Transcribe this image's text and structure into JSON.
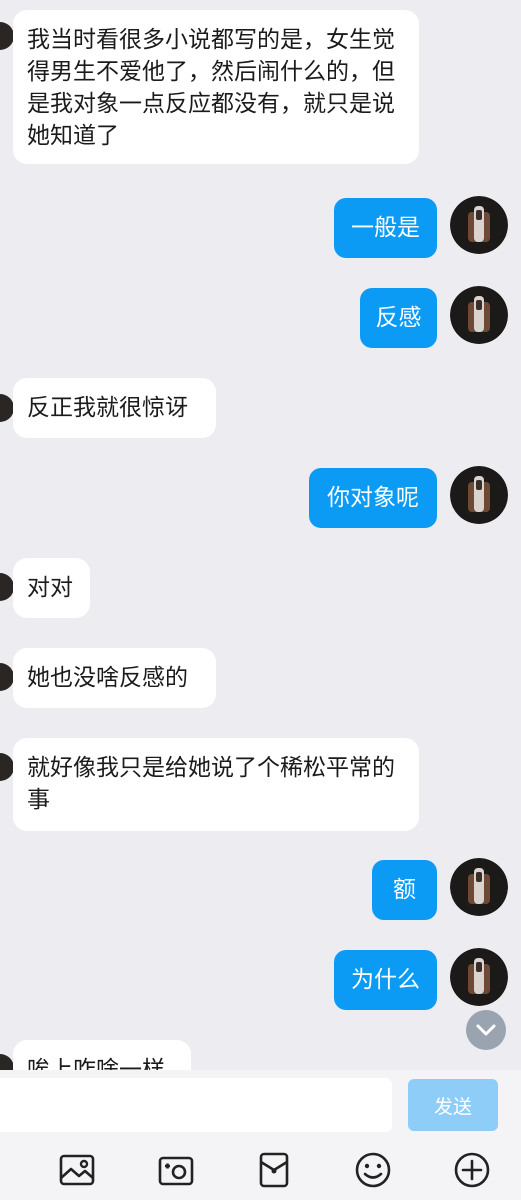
{
  "messages": [
    {
      "side": "in",
      "text": "我当时看很多小说都写的是，女生觉得男生不爱他了，然后闹什么的，但是我对象一点反应都没有，就只是说她知道了"
    },
    {
      "side": "out",
      "text": "一般是"
    },
    {
      "side": "out",
      "text": "反感"
    },
    {
      "side": "in",
      "text": "反正我就很惊讶"
    },
    {
      "side": "out",
      "text": "你对象呢"
    },
    {
      "side": "in",
      "text": "对对"
    },
    {
      "side": "in",
      "text": "她也没啥反感的"
    },
    {
      "side": "in",
      "text": "就好像我只是给她说了个稀松平常的事"
    },
    {
      "side": "out",
      "text": "额"
    },
    {
      "side": "out",
      "text": "为什么"
    },
    {
      "side": "in",
      "text": "唉上咋啥一样"
    }
  ],
  "composer": {
    "input_value": "",
    "send_label": "发送"
  },
  "toolbar": {
    "icons": [
      "image-icon",
      "camera-icon",
      "red-packet-icon",
      "emoji-icon",
      "plus-icon"
    ]
  },
  "colors": {
    "background": "#ececf1",
    "incoming_bubble": "#ffffff",
    "outgoing_bubble": "#0b9bf5",
    "send_button": "#8fcdf9"
  }
}
